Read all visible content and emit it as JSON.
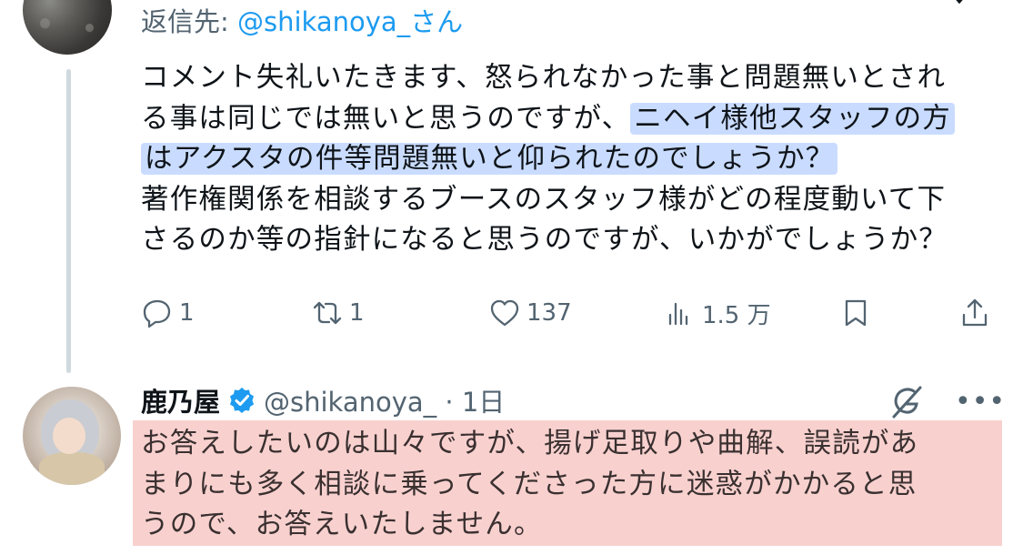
{
  "reply_context": {
    "prefix": "返信先: ",
    "handle": "@shikanoya_さん"
  },
  "tweet": {
    "lines": [
      {
        "text": "コメント失礼いたきます、怒られなかった事と問題無いとされ"
      },
      {
        "text": "る事は同じでは無いと思うのですが、",
        "highlight": "ニヘイ様他スタッフの方"
      },
      {
        "highlight": "はアクスタの件等問題無いと仰られたのでしょうか？"
      },
      {
        "text": "著作権関係を相談するブースのスタッフ様がどの程度動いて下"
      },
      {
        "text": "さるのか等の指針になると思うのですが、いかがでしょうか？"
      }
    ],
    "highlight_color": "#c9dcff"
  },
  "actions": {
    "reply": {
      "icon": "reply-icon",
      "count": "1"
    },
    "retweet": {
      "icon": "retweet-icon",
      "count": "1"
    },
    "like": {
      "icon": "heart-icon",
      "count": "137"
    },
    "views": {
      "icon": "views-icon",
      "count": "1.5 万"
    },
    "bookmark": {
      "icon": "bookmark-icon"
    },
    "share": {
      "icon": "share-icon"
    }
  },
  "reply": {
    "author_name": "鹿乃屋",
    "handle_time": "@shikanoya_ · 1日",
    "lines": [
      "お答えしたいのは山々ですが、揚げ足取りや曲解、誤読があ",
      "まりにも多く相談に乗ってくださった方に迷惑がかかると思",
      "うので、お答えいたしません。"
    ],
    "highlight_color": "#f8d1cf",
    "more_label": "•••"
  },
  "colors": {
    "accent": "#1d9bf0",
    "secondary_text": "#536471",
    "thread_line": "#cfd9de"
  }
}
